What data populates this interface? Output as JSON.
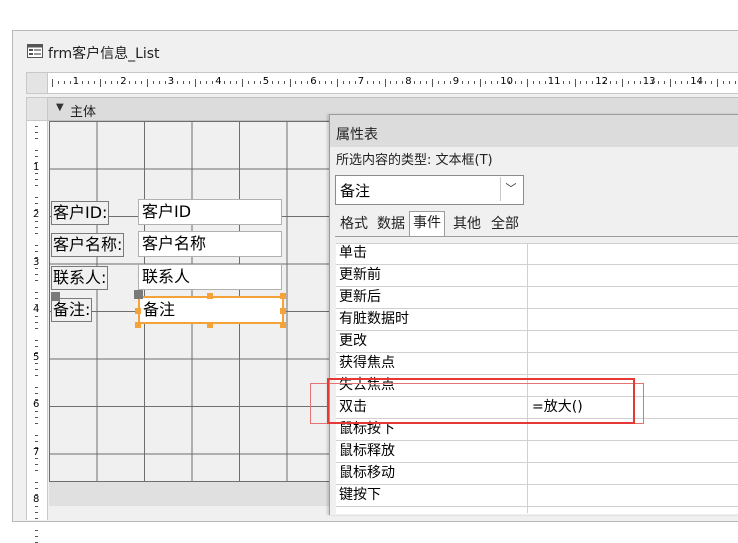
{
  "window": {
    "title": "frm客户信息_List"
  },
  "section": {
    "label": "主体"
  },
  "ruler": {
    "horizontal": [
      "1",
      "2",
      "3",
      "4",
      "5",
      "6",
      "7",
      "8",
      "9",
      "10",
      "11",
      "12",
      "13",
      "14"
    ],
    "vertical": [
      "1",
      "2",
      "3",
      "4",
      "5",
      "6",
      "7",
      "8"
    ]
  },
  "form_controls": [
    {
      "label": "客户ID:",
      "field": "客户ID"
    },
    {
      "label": "客户名称:",
      "field": "客户名称"
    },
    {
      "label": "联系人:",
      "field": "联系人"
    },
    {
      "label": "备注:",
      "field": "备注"
    }
  ],
  "property_sheet": {
    "title": "属性表",
    "selection_type_label": "所选内容的类型: 文本框(T)",
    "selected_object": "备注",
    "tabs": [
      "格式",
      "数据",
      "事件",
      "其他",
      "全部"
    ],
    "active_tab": "事件",
    "rows": [
      {
        "name": "单击",
        "value": ""
      },
      {
        "name": "更新前",
        "value": ""
      },
      {
        "name": "更新后",
        "value": ""
      },
      {
        "name": "有脏数据时",
        "value": ""
      },
      {
        "name": "更改",
        "value": ""
      },
      {
        "name": "获得焦点",
        "value": ""
      },
      {
        "name": "失去焦点",
        "value": ""
      },
      {
        "name": "双击",
        "value": "=放大()"
      },
      {
        "name": "鼠标按下",
        "value": ""
      },
      {
        "name": "鼠标释放",
        "value": ""
      },
      {
        "name": "鼠标移动",
        "value": ""
      },
      {
        "name": "键按下",
        "value": ""
      }
    ],
    "highlighted_row": "双击",
    "highlight_color": "#e53935"
  },
  "colors": {
    "selection_accent": "#f4a23a",
    "grid_line": "#6e6e6e"
  }
}
